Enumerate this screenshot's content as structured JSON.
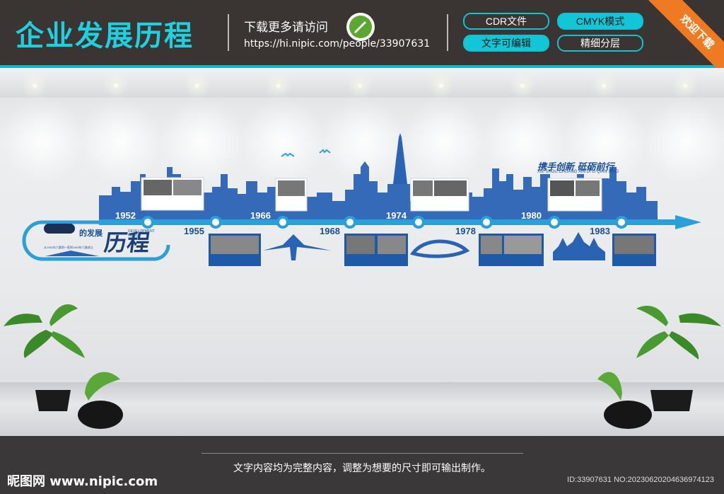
{
  "header": {
    "title": "企业发展历程",
    "download_text": "下载更多请访问",
    "download_url": "https://hi.nipic.com/people/33907631",
    "pills": [
      {
        "label": "CDR文件",
        "style": "outline"
      },
      {
        "label": "CMYK模式",
        "style": "filled"
      },
      {
        "label": "文字可编辑",
        "style": "filled"
      },
      {
        "label": "精细分层",
        "style": "outline"
      }
    ],
    "corner_ribbon": "欢迎下载"
  },
  "timeline": {
    "intro_title": "的发展",
    "intro_calligraphy": "历程",
    "intro_en": "DEVELOPMENT history",
    "intro_desc": "从1952年六路到一直到1983年六路成立",
    "slogan": "携手创新 砥砺前行",
    "slogan_sub": "XIE SHOU CHUANG XIN DI LI QIAN XING",
    "years_top": [
      "1952",
      "1966",
      "1974",
      "1980"
    ],
    "years_bottom": [
      "1955",
      "1968",
      "1978",
      "1983"
    ]
  },
  "footer": {
    "note": "文字内容均为完整内容，调整为想要的尺寸即可输出制作。",
    "site": "昵图网 www.nipic.com",
    "id_text": "ID:33907631 NO:20230620204636974123"
  },
  "colors": {
    "accent_cyan": "#11c6d6",
    "ribbon_orange": "#ef7a21",
    "timeline_blue": "#1b4f9c",
    "bar_dark": "#3a3533"
  }
}
